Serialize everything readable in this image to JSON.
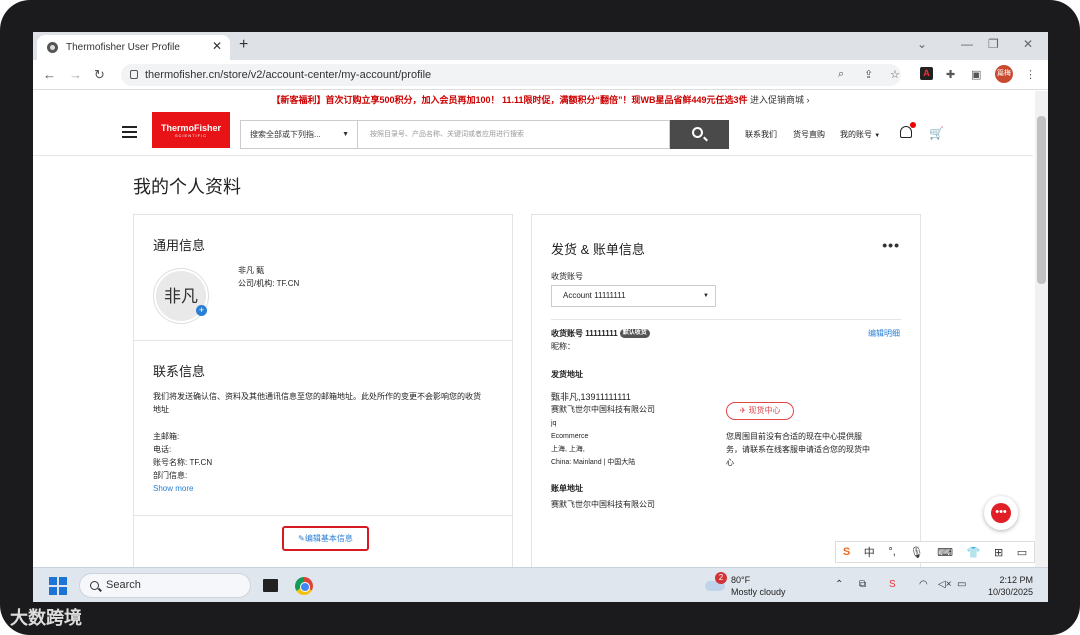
{
  "browser": {
    "tab_title": "Thermofisher User Profile",
    "url": "thermofisher.cn/store/v2/account-center/my-account/profile",
    "profile_chip": "篇梅"
  },
  "promo": {
    "part1": "【新客福利】首次订购立享500积分，加入会员再加100！ 11.11限时促，满额积分“翻倍”！现WB星品省鲜449元任选3件",
    "part2": " 进入促销商城 ›"
  },
  "header": {
    "logo_line1": "ThermoFisher",
    "logo_line2": "SCIENTIFIC",
    "category_select": "搜索全部或下列指...",
    "search_placeholder": "按照目录号、产品名称、关键词或者应用进行搜索",
    "contact": "联系我们",
    "quick_order": "货号直购",
    "my_account": "我的账号"
  },
  "page": {
    "title": "我的个人资料"
  },
  "general": {
    "title": "通用信息",
    "avatar_text": "非凡",
    "name": "非凡 甄",
    "company": "公司/机构: TF.CN"
  },
  "contact_info": {
    "title": "联系信息",
    "desc_line1": "我们将发送确认信、资料及其他通讯信息至您的邮箱地址。此处所作的变更不会影响您的收货",
    "desc_line2": "地址",
    "email": "主邮箱:",
    "phone": "电话:",
    "account_name": "账号名称: TF.CN",
    "dept": "部门信息:",
    "show_more": "Show more",
    "edit_button": "编辑基本信息"
  },
  "shipping": {
    "title": "发货 & 账单信息",
    "more": "•••",
    "account_label": "收货账号",
    "account_select": "Account  11111111",
    "account_line": "收货账号 11111111",
    "default_badge": "默认收货",
    "edit_link": "编辑明细",
    "nickname": "昵称：",
    "addr_title": "发货地址",
    "addr_name": "甄非凡,13911111111",
    "addr_company": "赛默飞世尔中国科技有限公司",
    "addr_l1": "jq",
    "addr_l2": "Ecommerce",
    "addr_l3": "上海, 上海,",
    "addr_l4": "China: Mainland | 中国大陆",
    "stock_pill": "现货中心",
    "stock_desc1": "您周围目前没有合适的现在中心提供服",
    "stock_desc2": "务，请联系在线客服申请适合您的现货中",
    "stock_desc3": "心",
    "bill_title": "账单地址",
    "bill_company": "赛默飞世尔中国科技有限公司"
  },
  "ime": {
    "s": "S",
    "zh": "中",
    "punct": "°,"
  },
  "taskbar": {
    "search": "Search",
    "weather_badge": "2",
    "temp": "80°F",
    "condition": "Mostly cloudy",
    "time": "2:12 PM",
    "date": "10/30/2025"
  },
  "watermark": "大数跨境"
}
